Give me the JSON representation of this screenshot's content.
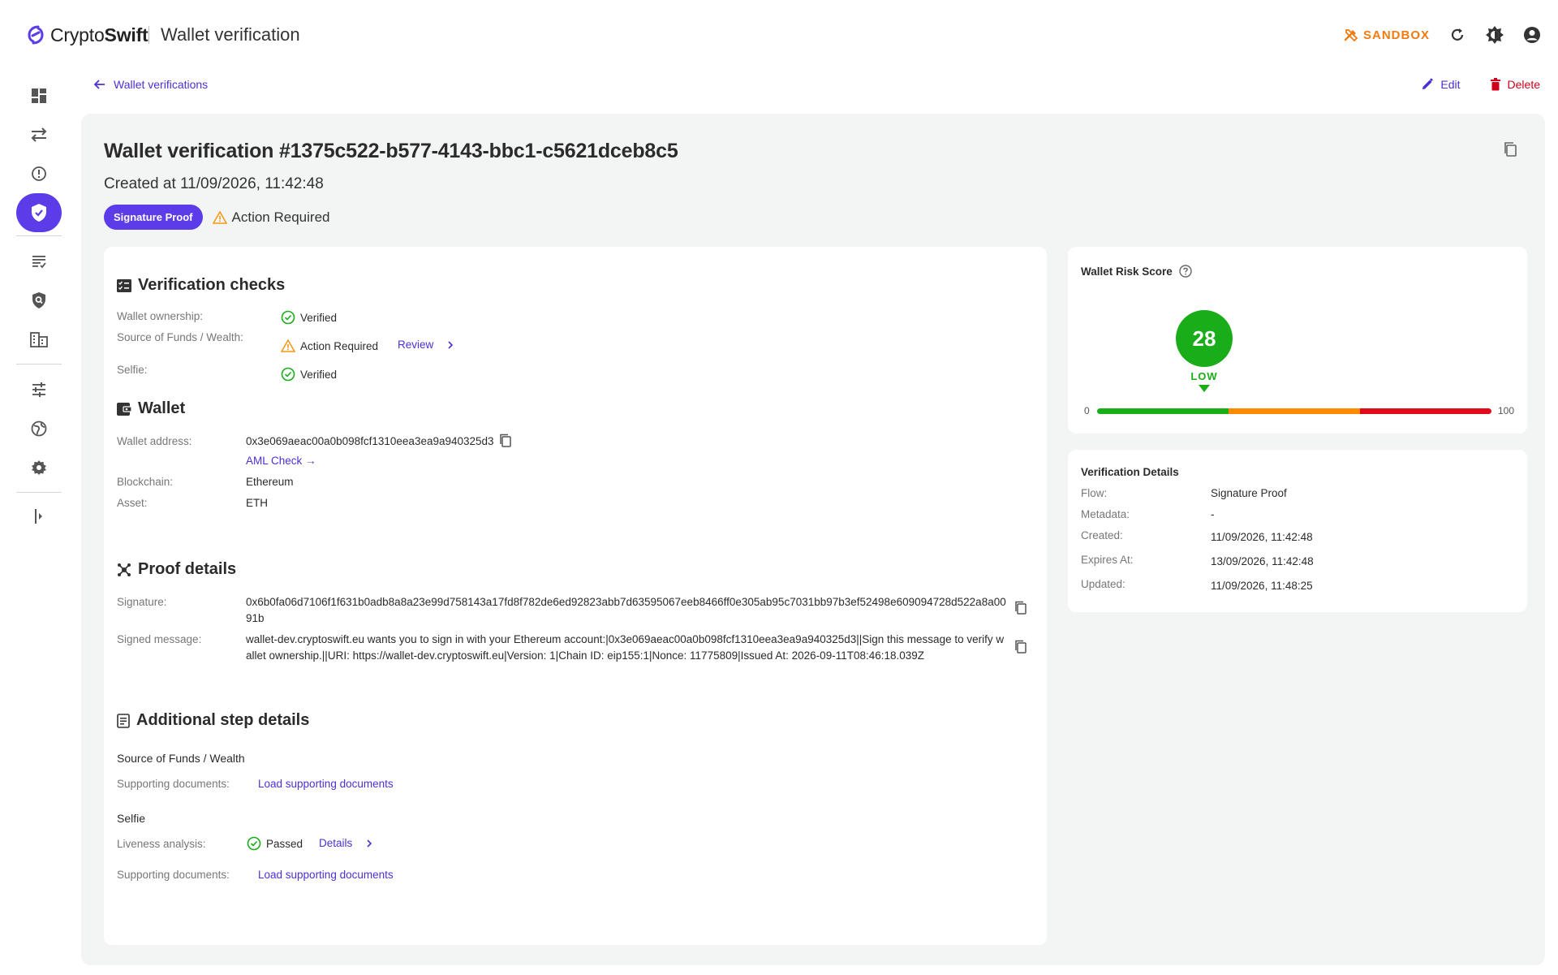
{
  "header": {
    "brand_plain": "Crypto",
    "brand_bold": "Swift",
    "page_name": "Wallet verification",
    "sandbox_label": "SANDBOX",
    "icons": [
      "refresh-icon",
      "theme-icon",
      "account-icon"
    ]
  },
  "sidebar": {
    "items": [
      {
        "name": "dashboard-icon"
      },
      {
        "name": "transactions-icon"
      },
      {
        "name": "alerts-icon"
      },
      {
        "name": "wallet-verification-icon",
        "active": true
      },
      {
        "name": "reports-icon"
      },
      {
        "name": "screening-icon"
      },
      {
        "name": "organization-icon"
      },
      {
        "name": "rules-icon"
      },
      {
        "name": "integrations-icon"
      },
      {
        "name": "settings-icon"
      },
      {
        "name": "collapse-sidebar-icon"
      }
    ]
  },
  "nav": {
    "back_label": "Wallet verifications",
    "edit_label": "Edit",
    "delete_label": "Delete"
  },
  "verification": {
    "title": "Wallet verification #1375c522-b577-4143-bbc1-c5621dceb8c5",
    "created": "Created at 11/09/2026, 11:42:48",
    "chip": "Signature Proof",
    "status": "Action Required"
  },
  "checks": {
    "title": "Verification checks",
    "rows": [
      {
        "label": "Wallet ownership:",
        "status": "Verified"
      },
      {
        "label": "Source of Funds / Wealth:",
        "status": "Action Required",
        "link": "Review"
      },
      {
        "label": "Selfie:",
        "status": "Verified"
      }
    ]
  },
  "wallet": {
    "title": "Wallet",
    "address_label": "Wallet address:",
    "address": "0x3e069aeac00a0b098fcf1310eea3ea9a940325d3",
    "aml_link": "AML Check →",
    "blockchain_label": "Blockchain:",
    "blockchain": "Ethereum",
    "asset_label": "Asset:",
    "asset": "ETH"
  },
  "proof": {
    "title": "Proof details",
    "signature_label": "Signature:",
    "signature": "0x6b0fa06d7106f1f631b0adb8a8a23e99d758143a17fd8f782de6ed92823abb7d63595067eeb8466ff0e305ab95c7031bb97b3ef52498e609094728d522a8a0091b",
    "message_label": "Signed message:",
    "message": "wallet-dev.cryptoswift.eu wants you to sign in with your Ethereum account:|0x3e069aeac00a0b098fcf1310eea3ea9a940325d3||Sign this message to verify wallet ownership.||URI: https://wallet-dev.cryptoswift.eu|Version: 1|Chain ID: eip155:1|Nonce: 11775809|Issued At: 2026-09-11T08:46:18.039Z"
  },
  "additional": {
    "title": "Additional step details",
    "sof_heading": "Source of Funds / Wealth",
    "sof_docs_label": "Supporting documents:",
    "sof_docs_link": "Load supporting documents",
    "selfie_heading": "Selfie",
    "liveness_label": "Liveness analysis:",
    "liveness_status": "Passed",
    "liveness_link": "Details",
    "selfie_docs_label": "Supporting documents:",
    "selfie_docs_link": "Load supporting documents"
  },
  "risk": {
    "title": "Wallet Risk Score",
    "score": "28",
    "level": "LOW",
    "score_value": 28,
    "scale_min": "0",
    "scale_max": "100",
    "colors": {
      "low": "#19ad19",
      "medium": "#ff8a00",
      "high": "#e00a1a"
    }
  },
  "details": {
    "title": "Verification Details",
    "rows": [
      {
        "label": "Flow:",
        "value": "Signature Proof"
      },
      {
        "label": "Metadata:",
        "value": "-"
      },
      {
        "label": "Created:",
        "value": "11/09/2026, 11:42:48"
      },
      {
        "label": "Expires At:",
        "value": "13/09/2026, 11:42:48"
      },
      {
        "label": "Updated:",
        "value": "11/09/2026, 11:48:25"
      }
    ]
  }
}
